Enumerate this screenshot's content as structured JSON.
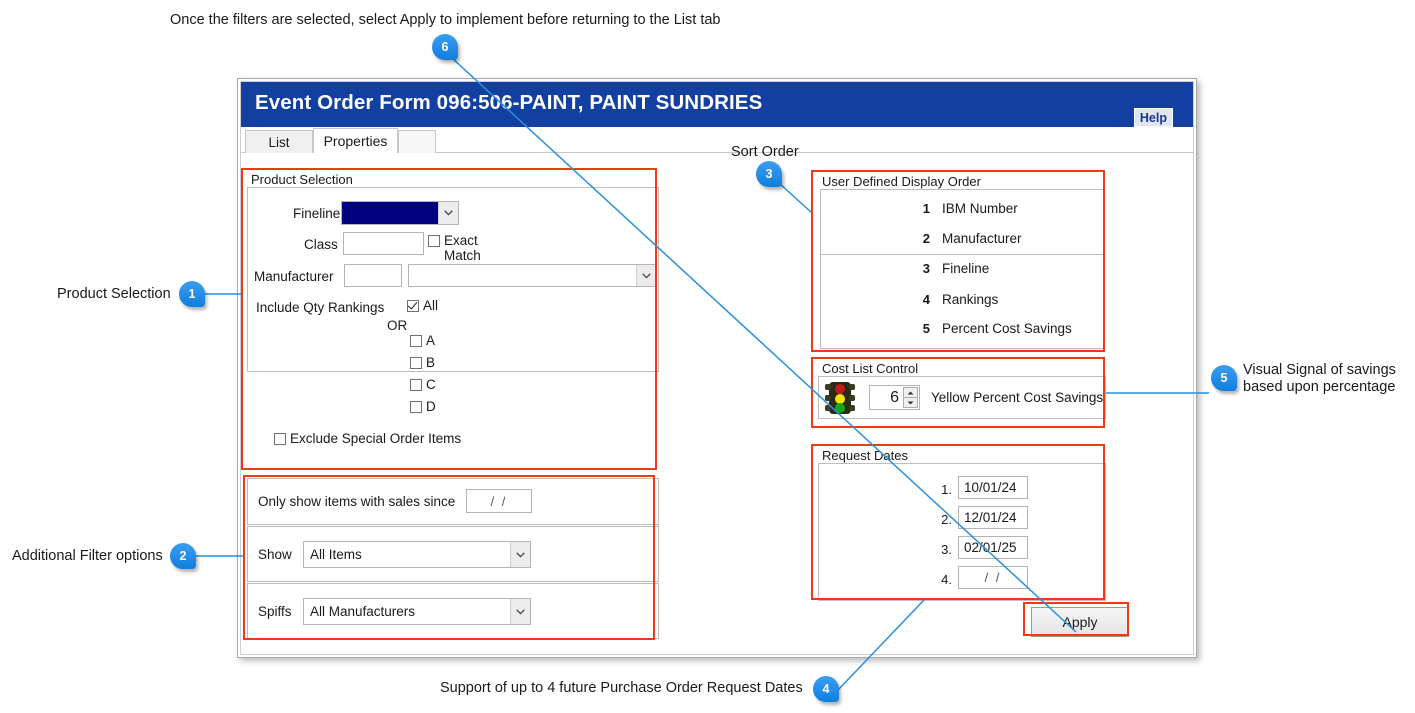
{
  "annotations": {
    "top_note": "Once the filters are selected, select Apply to implement before returning to the List tab",
    "bottom_note": "Support of up to 4 future Purchase Order Request Dates",
    "left_note_1": "Product Selection",
    "left_note_2": "Additional Filter options",
    "right_note_5_line1": "Visual Signal of savings",
    "right_note_5_line2": "based upon percentage",
    "badges": {
      "one": "1",
      "two": "2",
      "three": "3",
      "four": "4",
      "five": "5",
      "six": "6"
    },
    "accent_color": "#1f8ded",
    "highlight_color": "#ed3a13"
  },
  "window": {
    "title": "Event Order Form 096:506-PAINT, PAINT SUNDRIES",
    "title_bar_color": "#123fa0",
    "help_label": "Help",
    "tabs": [
      {
        "label": "List",
        "active": false
      },
      {
        "label": "Properties",
        "active": true
      }
    ],
    "sort_order_header": "Sort Order"
  },
  "product_selection": {
    "legend": "Product Selection",
    "fineline_label": "Fineline",
    "fineline_value": "",
    "fineline_highlight_color": "#000080",
    "class_label": "Class",
    "class_value": "",
    "exact_match_label": "Exact\nMatch",
    "exact_match_checked": false,
    "manufacturer_label": "Manufacturer",
    "manufacturer_code_value": "",
    "manufacturer_name_value": "",
    "rankings_label": "Include Qty Rankings",
    "rankings_all_label": "All",
    "rankings_all_checked": true,
    "or_label": "OR",
    "rankings": [
      {
        "label": "A",
        "checked": false
      },
      {
        "label": "B",
        "checked": false
      },
      {
        "label": "C",
        "checked": false
      },
      {
        "label": "D",
        "checked": false
      }
    ],
    "exclude_special_label": "Exclude Special Order Items",
    "exclude_special_checked": false
  },
  "additional_filters": {
    "sales_since_label": "Only show items with sales since",
    "sales_since_value": "/  /",
    "show_label": "Show",
    "show_value": "All Items",
    "spiffs_label": "Spiffs",
    "spiffs_value": "All Manufacturers"
  },
  "display_order": {
    "legend": "User Defined Display Order",
    "items": [
      {
        "num": "1",
        "label": "IBM Number"
      },
      {
        "num": "2",
        "label": "Manufacturer"
      },
      {
        "num": "3",
        "label": "Fineline"
      },
      {
        "num": "4",
        "label": "Rankings"
      },
      {
        "num": "5",
        "label": "Percent Cost Savings"
      }
    ]
  },
  "cost_list_control": {
    "legend": "Cost List Control",
    "icon": "traffic-light-icon",
    "value": "6",
    "label": "Yellow Percent Cost Savings"
  },
  "request_dates": {
    "legend": "Request Dates",
    "rows": [
      {
        "num": "1.",
        "value": "10/01/24"
      },
      {
        "num": "2.",
        "value": "12/01/24"
      },
      {
        "num": "3.",
        "value": "02/01/25"
      },
      {
        "num": "4.",
        "value": "/  /"
      }
    ]
  },
  "apply": {
    "label": "Apply"
  }
}
